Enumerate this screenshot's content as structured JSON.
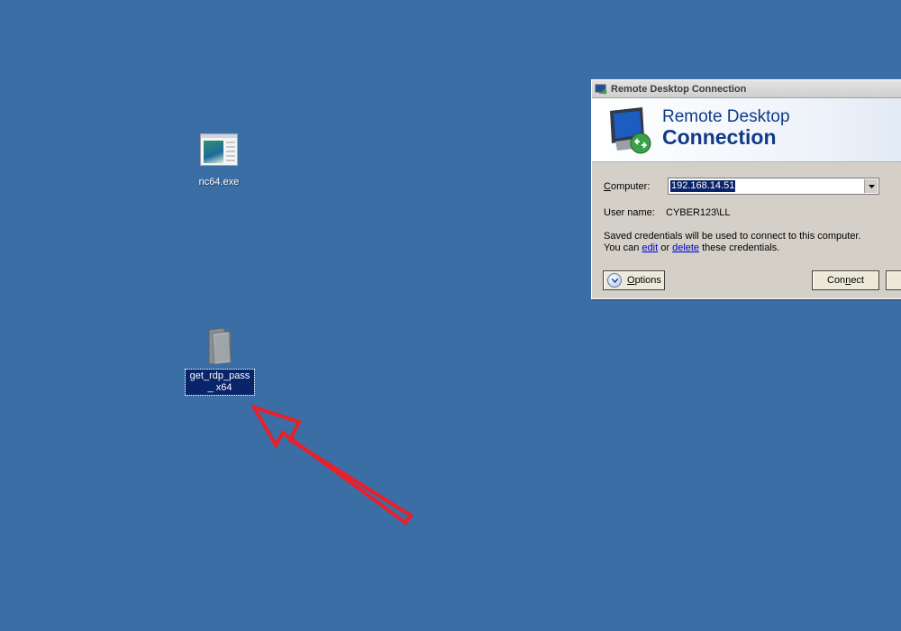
{
  "desktop": {
    "background_color": "#3a6ea5",
    "icons": [
      {
        "label": "nc64.exe",
        "icon": "executable-icon",
        "selected": false
      },
      {
        "label": "get_rdp_pass_ x64",
        "icon": "folder-icon",
        "selected": true
      }
    ],
    "annotation": {
      "type": "arrow",
      "color": "#e8202a",
      "points_to": "get_rdp_pass_ x64"
    }
  },
  "dialog": {
    "title": "Remote Desktop Connection",
    "banner_line1": "Remote Desktop",
    "banner_line2": "Connection",
    "computer_label": "Computer:",
    "computer_value": "192.168.14.51",
    "username_label": "User name:",
    "username_value": "CYBER123\\LL",
    "credentials_line1": "Saved credentials will be used to connect to this computer.",
    "credentials_line2_prefix": "You can",
    "edit_link": "edit",
    "credentials_or": "or",
    "delete_link": "delete",
    "credentials_line2_suffix": "these credentials.",
    "options_label": "Options",
    "connect_label": "Connect"
  }
}
